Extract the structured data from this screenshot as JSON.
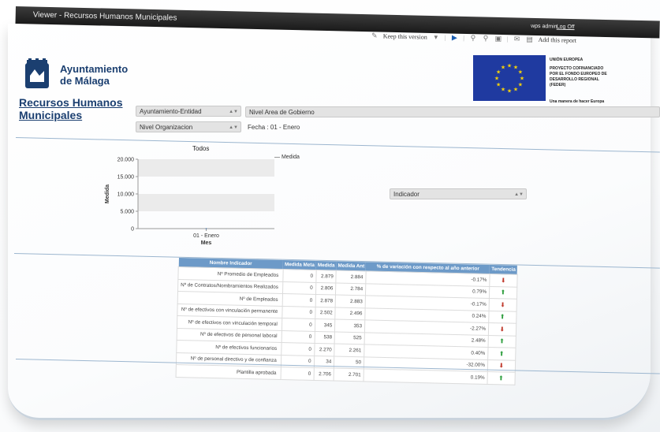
{
  "window": {
    "title": "Viewer - Recursos Humanos Municipales",
    "user": "wps admin",
    "logout": "Log Off"
  },
  "toolbar": {
    "keep_version": "Keep this version",
    "add_report": "Add this report"
  },
  "header": {
    "org_line1": "Ayuntamiento",
    "org_line2": "de Málaga",
    "eu": {
      "title": "UNIÓN EUROPEA",
      "line1": "PROYECTO COFINANCIADO",
      "line2": "POR EL FONDO EUROPEO DE",
      "line3": "DESARROLLO REGIONAL",
      "line4": "(FEDER)",
      "slogan": "Una manera de hacer Europa"
    }
  },
  "report": {
    "title_line1": "Recursos Humanos",
    "title_line2": "Municipales"
  },
  "filters": {
    "entidad": "Ayuntamiento-Entidad",
    "area": "Nivel Area de Gobierno",
    "organizacion": "Nivel Organizacion",
    "fecha": "Fecha : 01 - Enero",
    "indicador": "Indicador"
  },
  "chart_data": {
    "type": "bar",
    "title": "Todos",
    "categories": [
      "01 - Enero"
    ],
    "series": [
      {
        "name": "Medida",
        "values": [
          0
        ]
      }
    ],
    "xlabel": "Mes",
    "ylabel": "Medida",
    "ylim": [
      0,
      20000
    ],
    "yticks": [
      "0",
      "5.000",
      "10.000",
      "15.000",
      "20.000"
    ],
    "legend": "top-right",
    "colors": {
      "band": "#ebebeb",
      "axis": "#999999"
    }
  },
  "table": {
    "headers": [
      "Nombre Indicador",
      "Medida Meta",
      "Medida",
      "Medida Ant",
      "% de variación con respecto al año anterior",
      "Tendencia"
    ],
    "rows": [
      {
        "name": "Nº Promedio de Empleados",
        "meta": "0",
        "medida": "2.879",
        "ant": "2.884",
        "var": "-0.17%",
        "trend": "down"
      },
      {
        "name": "Nº de Contratos/Nombramientos Realizados",
        "meta": "0",
        "medida": "2.806",
        "ant": "2.784",
        "var": "0.79%",
        "trend": "up"
      },
      {
        "name": "Nº de Empleados",
        "meta": "0",
        "medida": "2.878",
        "ant": "2.883",
        "var": "-0.17%",
        "trend": "down"
      },
      {
        "name": "Nº de efectivos con vinculación permanente",
        "meta": "0",
        "medida": "2.502",
        "ant": "2.496",
        "var": "0.24%",
        "trend": "up"
      },
      {
        "name": "Nº de efectivos con vinculación temporal",
        "meta": "0",
        "medida": "345",
        "ant": "353",
        "var": "-2.27%",
        "trend": "down"
      },
      {
        "name": "Nº de efectivos de personal laboral",
        "meta": "0",
        "medida": "538",
        "ant": "525",
        "var": "2.48%",
        "trend": "up"
      },
      {
        "name": "Nº de efectivos funcionarios",
        "meta": "0",
        "medida": "2.270",
        "ant": "2.261",
        "var": "0.40%",
        "trend": "up"
      },
      {
        "name": "Nº de personal directivo y de confianza",
        "meta": "0",
        "medida": "34",
        "ant": "50",
        "var": "-32.00%",
        "trend": "down"
      },
      {
        "name": "Plantilla aprobada",
        "meta": "0",
        "medida": "2.706",
        "ant": "2.701",
        "var": "0.19%",
        "trend": "up"
      }
    ]
  }
}
